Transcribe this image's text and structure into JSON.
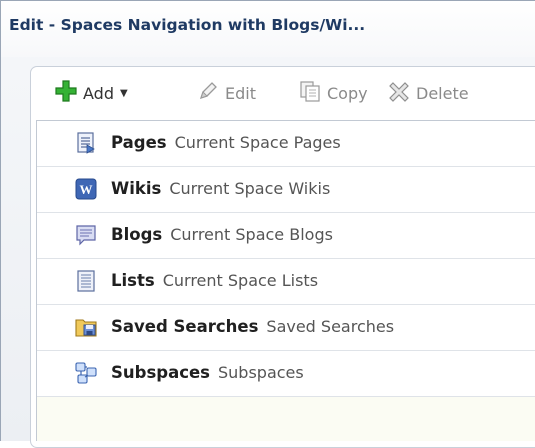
{
  "window": {
    "title": "Edit - Spaces Navigation with Blogs/Wi..."
  },
  "toolbar": {
    "add_label": "Add",
    "edit_label": "Edit",
    "copy_label": "Copy",
    "delete_label": "Delete"
  },
  "items": [
    {
      "name": "Pages",
      "desc": "Current Space Pages",
      "icon": "pages-icon"
    },
    {
      "name": "Wikis",
      "desc": "Current Space Wikis",
      "icon": "wiki-icon"
    },
    {
      "name": "Blogs",
      "desc": "Current Space Blogs",
      "icon": "blog-icon"
    },
    {
      "name": "Lists",
      "desc": "Current Space Lists",
      "icon": "list-icon"
    },
    {
      "name": "Saved Searches",
      "desc": "Saved Searches",
      "icon": "saved-search-icon"
    },
    {
      "name": "Subspaces",
      "desc": "Subspaces",
      "icon": "subspaces-icon"
    }
  ],
  "colors": {
    "title": "#1f3a63",
    "add_green": "#2fa52f",
    "list_background": "#fbfcf3"
  }
}
